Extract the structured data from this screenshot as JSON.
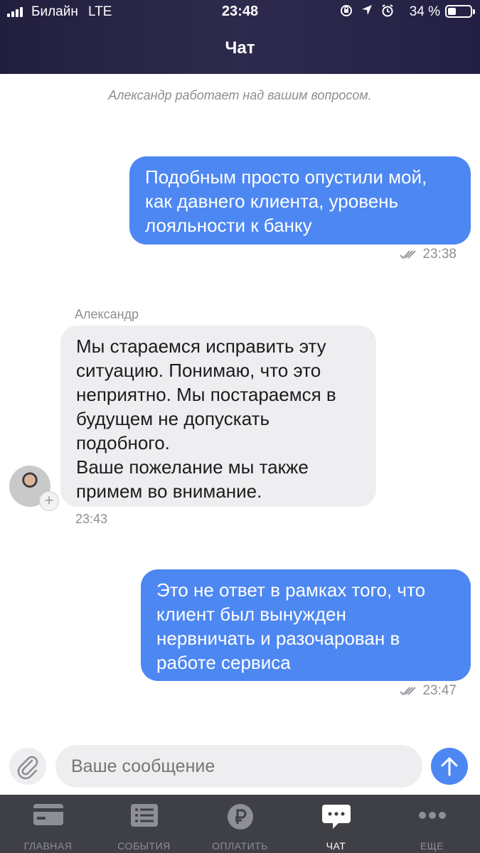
{
  "status_bar": {
    "carrier": "Билайн",
    "network": "LTE",
    "time": "23:48",
    "battery": "34 %"
  },
  "header": {
    "title": "Чат"
  },
  "chat": {
    "info": "Александр работает над вашим вопросом.",
    "messages": [
      {
        "direction": "outgoing",
        "text": "Подобным просто опустили мой,\nкак давнего клиента, уровень\nлояльности к банку",
        "time": "23:38"
      },
      {
        "direction": "incoming",
        "sender": "Александр",
        "text": "Мы стараемся исправить эту\nситуацию. Понимаю, что это\nнеприятно. Мы постараемся в\nбудущем не допускать\nподобного.\nВаше пожелание мы также\nпримем во внимание.",
        "time": "23:43"
      },
      {
        "direction": "outgoing",
        "text": "Это не ответ в рамках того, что\nклиент был вынужден\nнервничать и разочарован в\nработе сервиса",
        "time": "23:47"
      }
    ]
  },
  "composer": {
    "placeholder": "Ваше сообщение",
    "attach_icon": "paperclip-icon",
    "send_icon": "arrow-up-icon"
  },
  "tabbar": {
    "items": [
      {
        "label": "ГЛАВНАЯ",
        "icon": "card-icon"
      },
      {
        "label": "СОБЫТИЯ",
        "icon": "list-icon"
      },
      {
        "label": "ОПЛАТИТЬ",
        "icon": "ruble-icon"
      },
      {
        "label": "ЧАТ",
        "icon": "chat-icon",
        "active": true
      },
      {
        "label": "ЕЩЕ",
        "icon": "more-dots-icon"
      }
    ]
  },
  "colors": {
    "accent": "#4d87f2",
    "header": "#2a274a",
    "tabbar": "#3f3f46"
  }
}
